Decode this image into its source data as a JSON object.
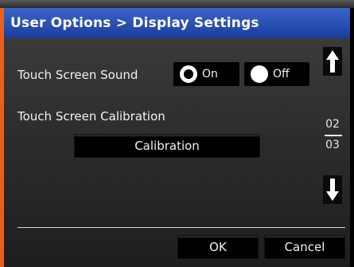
{
  "title": "User Options > Display Settings",
  "sound": {
    "label": "Touch Screen Sound",
    "options": [
      {
        "label": "On",
        "selected": true
      },
      {
        "label": "Off",
        "selected": false
      }
    ]
  },
  "calibration": {
    "label": "Touch Screen Calibration",
    "button": "Calibration"
  },
  "pager": {
    "current": "02",
    "total": "03"
  },
  "footer": {
    "ok": "OK",
    "cancel": "Cancel"
  },
  "colors": {
    "titlebar": "#2a50b6",
    "accent_edge": "#e8601c"
  }
}
